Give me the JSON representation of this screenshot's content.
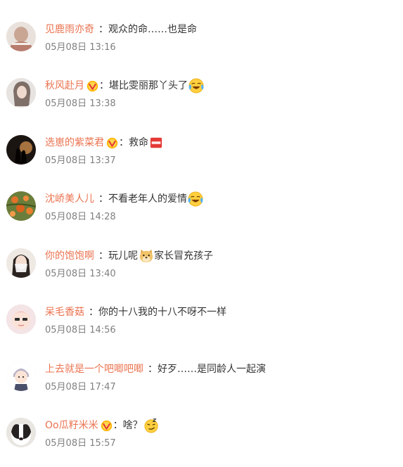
{
  "comments": [
    {
      "username": "见鹿雨亦奇",
      "text": "观众的命……也是命",
      "time": "05月08日 13:16",
      "vip": false,
      "emoji": ""
    },
    {
      "username": "秋风赴月",
      "text": "堪比雯丽那丫头了",
      "time": "05月08日 13:38",
      "vip": true,
      "emoji": "laugh-cry-emoji"
    },
    {
      "username": "选崽的紫菜君",
      "text": "救命",
      "time": "05月08日 13:37",
      "vip": true,
      "emoji": "sos-emoji"
    },
    {
      "username": "沈峤美人儿",
      "text": "不看老年人的爱情",
      "time": "05月08日 14:28",
      "vip": false,
      "emoji": "laugh-cry-emoji"
    },
    {
      "username": "你的饱饱啊",
      "text_before": "玩儿呢",
      "text_after": "家长冒充孩子",
      "time": "05月08日 13:40",
      "vip": false,
      "emoji": "doge-emoji"
    },
    {
      "username": "呆毛香菇",
      "text": "你的十八我的十八不呀不一样",
      "time": "05月08日 14:56",
      "vip": false,
      "emoji": ""
    },
    {
      "username": "上去就是一个吧唧吧唧",
      "text": "好歹……是同龄人一起演",
      "time": "05月08日 17:47",
      "vip": false,
      "emoji": ""
    },
    {
      "username": "Oo瓜籽米米",
      "text": "啥？",
      "time": "05月08日 15:57",
      "vip": true,
      "emoji": "smirk-emoji"
    }
  ],
  "colon": "："
}
